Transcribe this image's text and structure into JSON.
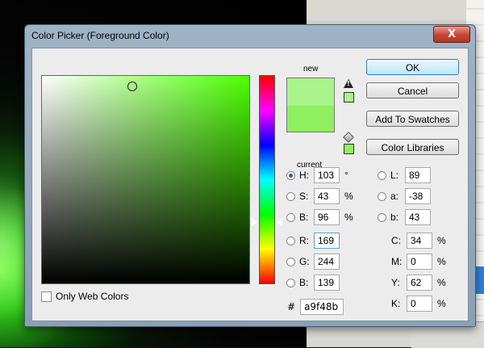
{
  "dialog": {
    "title": "Color Picker (Foreground Color)",
    "close_label": "X"
  },
  "preview": {
    "new_label": "new",
    "current_label": "current",
    "new_color": "#a9f48b",
    "current_color": "#8ef05e"
  },
  "buttons": {
    "ok": "OK",
    "cancel": "Cancel",
    "add_to_swatches": "Add To Swatches",
    "color_libraries": "Color Libraries"
  },
  "web_colors": {
    "label": "Only Web Colors",
    "checked": false
  },
  "hsb": {
    "h": {
      "label": "H:",
      "value": "103",
      "unit": "°",
      "selected": true
    },
    "s": {
      "label": "S:",
      "value": "43",
      "unit": "%",
      "selected": false
    },
    "b": {
      "label": "B:",
      "value": "96",
      "unit": "%",
      "selected": false
    }
  },
  "rgb": {
    "r": {
      "label": "R:",
      "value": "169"
    },
    "g": {
      "label": "G:",
      "value": "244"
    },
    "b": {
      "label": "B:",
      "value": "139"
    }
  },
  "lab": {
    "l": {
      "label": "L:",
      "value": "89"
    },
    "a": {
      "label": "a:",
      "value": "-38"
    },
    "b": {
      "label": "b:",
      "value": "43"
    }
  },
  "cmyk": {
    "c": {
      "label": "C:",
      "value": "34",
      "unit": "%"
    },
    "m": {
      "label": "M:",
      "value": "0",
      "unit": "%"
    },
    "y": {
      "label": "Y:",
      "value": "62",
      "unit": "%"
    },
    "k": {
      "label": "K:",
      "value": "0",
      "unit": "%"
    }
  },
  "hex": {
    "prefix": "#",
    "value": "a9f48b"
  },
  "icons": {
    "gamut_warning": "warning-triangle-icon",
    "web_safe": "cube-icon"
  }
}
